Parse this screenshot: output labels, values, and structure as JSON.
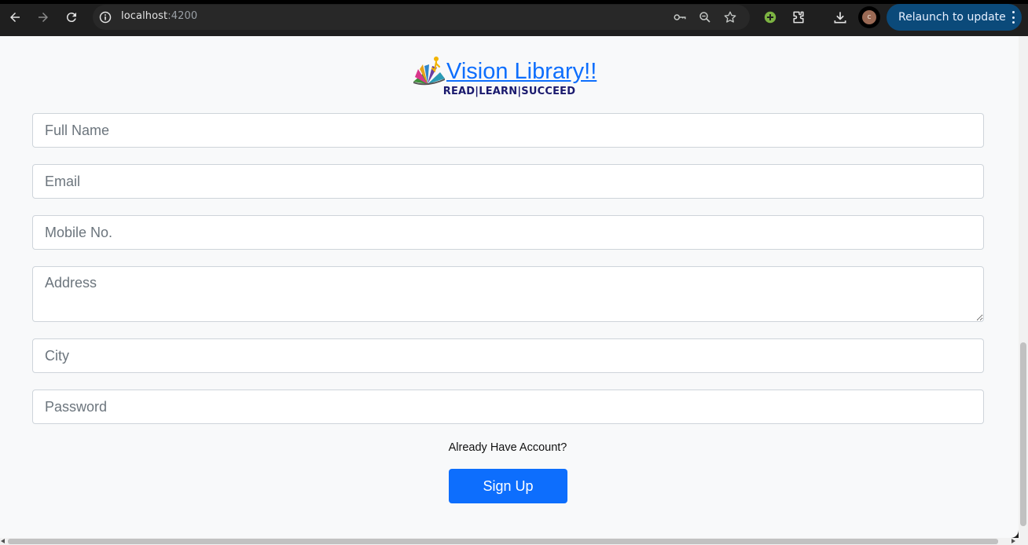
{
  "browser": {
    "url_host": "localhost",
    "url_port": ":4200",
    "relaunch_label": "Relaunch to update",
    "avatar_initial": "c"
  },
  "header": {
    "title": "Vision Library!!",
    "tagline": "READ|LEARN|SUCCEED"
  },
  "form": {
    "full_name_placeholder": "Full Name",
    "email_placeholder": "Email",
    "mobile_placeholder": "Mobile No.",
    "address_placeholder": "Address",
    "city_placeholder": "City",
    "password_placeholder": "Password",
    "already_account": "Already Have Account?",
    "signup_label": "Sign Up"
  },
  "colors": {
    "primary": "#0d6efd",
    "tagline": "#1a1a6e",
    "page_bg": "#f8f9fa"
  }
}
